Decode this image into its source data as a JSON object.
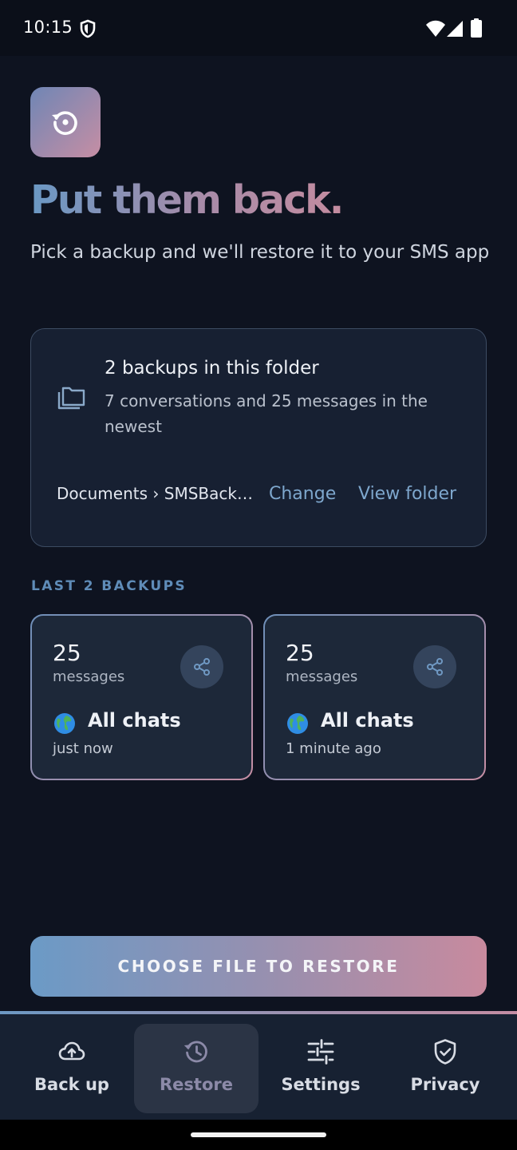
{
  "status_bar": {
    "time": "10:15"
  },
  "hero": {
    "icon": "restore-history-icon",
    "title": "Put them back.",
    "subtitle": "Pick a backup and we'll restore it to your SMS app"
  },
  "folder_card": {
    "icon": "folder-icon",
    "title": "2 backups in this folder",
    "description": "7 conversations and 25 messages in the newest",
    "path": "Documents › SMSBack…",
    "change_label": "Change",
    "view_folder_label": "View folder"
  },
  "backups": {
    "section_label": "LAST 2 BACKUPS",
    "items": [
      {
        "count": "25",
        "unit": "messages",
        "scope": "All chats",
        "time": "just now"
      },
      {
        "count": "25",
        "unit": "messages",
        "scope": "All chats",
        "time": "1 minute ago"
      }
    ]
  },
  "primary_action": {
    "label": "CHOOSE FILE TO RESTORE"
  },
  "nav": {
    "active": "Restore",
    "items": [
      {
        "label": "Back up",
        "icon": "cloud-upload-icon"
      },
      {
        "label": "Restore",
        "icon": "history-icon"
      },
      {
        "label": "Settings",
        "icon": "sliders-icon"
      },
      {
        "label": "Privacy",
        "icon": "shield-check-icon"
      }
    ]
  },
  "colors": {
    "background": "#0e1320",
    "accent_blue": "#6b9ac6",
    "accent_pink": "#c88a9e",
    "link": "#7ea7cd",
    "card": "#172032"
  }
}
